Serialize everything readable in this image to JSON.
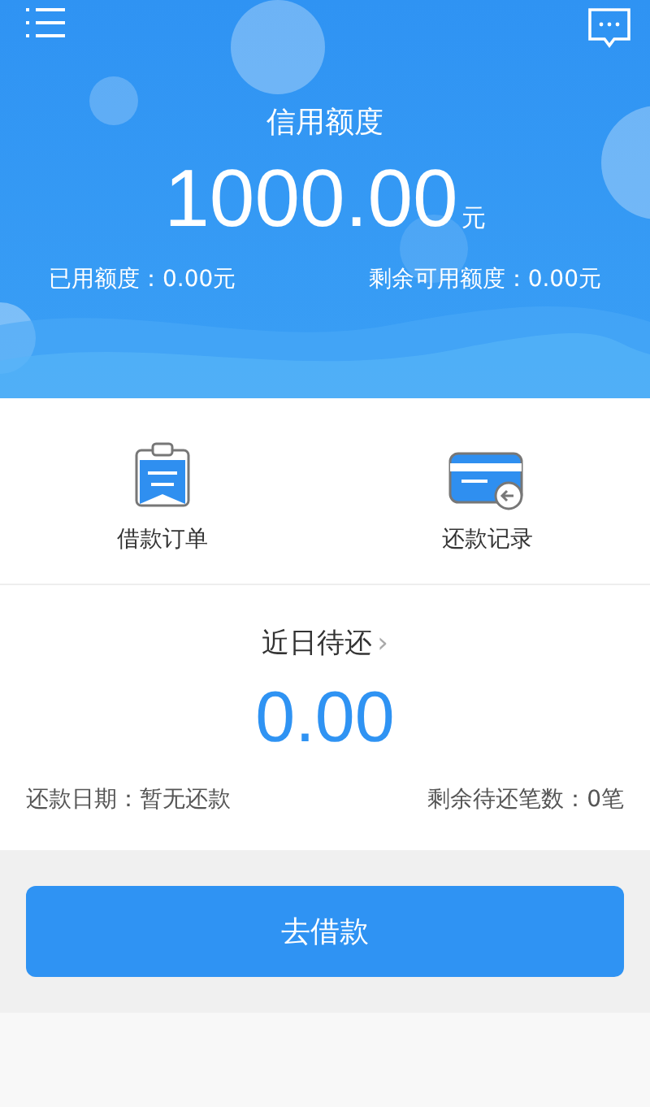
{
  "header": {
    "title": "信用额度",
    "amount": "1000.00",
    "unit": "元",
    "used": "已用额度：0.00元",
    "remaining": "剩余可用额度：0.00元"
  },
  "shortcuts": [
    {
      "kind": "order",
      "label": "借款订单"
    },
    {
      "kind": "repay",
      "label": "还款记录"
    }
  ],
  "repayment": {
    "title": "近日待还",
    "chevron": "›",
    "amount": "0.00",
    "date": "还款日期：暂无还款",
    "count": "剩余待还笔数：0笔"
  },
  "action": {
    "label": "去借款"
  }
}
